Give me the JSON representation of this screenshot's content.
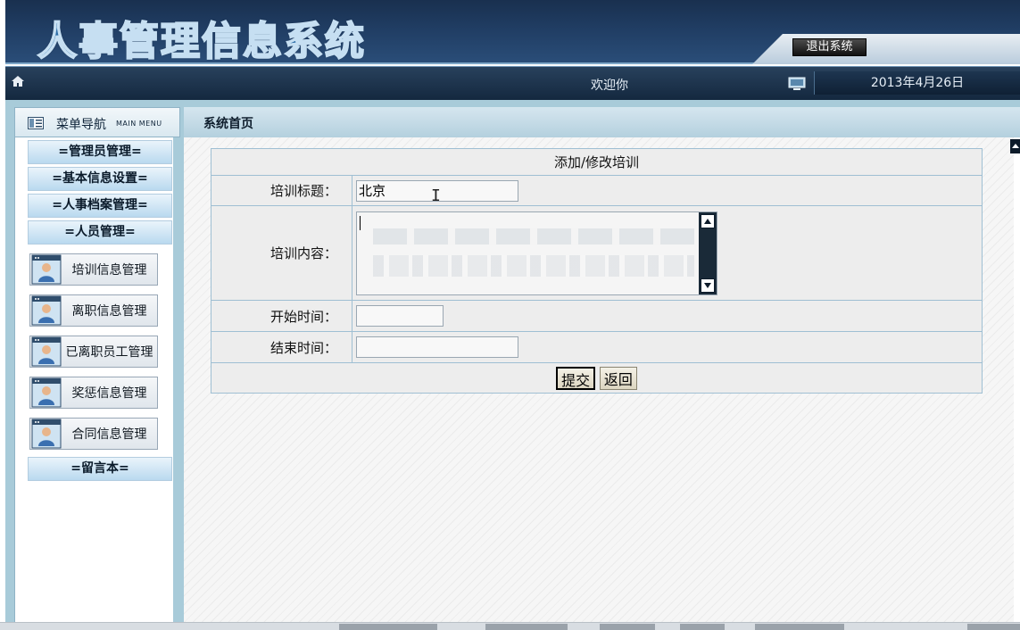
{
  "app": {
    "title": "人事管理信息系统",
    "exit_label": "退出系统"
  },
  "welcome_bar": {
    "welcome_text": "欢迎你",
    "date": "2013年4月26日"
  },
  "sidebar": {
    "title": "菜单导航",
    "subtitle": "MAIN MENU",
    "sections": [
      {
        "label": "=管理员管理="
      },
      {
        "label": "=基本信息设置="
      },
      {
        "label": "=人事档案管理="
      },
      {
        "label": "=人员管理="
      }
    ],
    "items": [
      {
        "label": "培训信息管理"
      },
      {
        "label": "离职信息管理"
      },
      {
        "label": "已离职员工管理"
      },
      {
        "label": "奖惩信息管理"
      },
      {
        "label": "合同信息管理"
      }
    ],
    "guestbook": "=留言本="
  },
  "breadcrumb": "系统首页",
  "form": {
    "caption": "添加/修改培训",
    "title_label": "培训标题：",
    "title_value": "北京",
    "content_label": "培训内容：",
    "start_label": "开始时间：",
    "start_value": "",
    "end_label": "结束时间：",
    "end_value": "",
    "submit_label": "提交",
    "back_label": "返回"
  },
  "colors": {
    "banner": "#203d63",
    "welcome_bar": "#14283f",
    "shell": "#a8cbd9",
    "table_border": "#9fbfd3"
  }
}
